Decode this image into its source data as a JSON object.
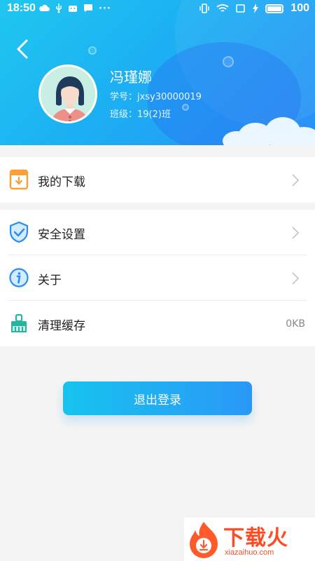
{
  "status_bar": {
    "time": "18:50",
    "battery": "100"
  },
  "profile": {
    "name": "冯瑾娜",
    "student_id": "学号：jxsy30000019",
    "class": "班级：19(2)班"
  },
  "menu_group_1": [
    {
      "label": "我的下载",
      "icon": "download-book-icon"
    }
  ],
  "menu_group_2": [
    {
      "label": "安全设置",
      "icon": "shield-check-icon"
    },
    {
      "label": "关于",
      "icon": "info-icon"
    },
    {
      "label": "清理缓存",
      "icon": "broom-icon",
      "value": "0KB"
    }
  ],
  "logout_label": "退出登录",
  "watermark": {
    "title": "下载火",
    "site": "xiazaihuo.com"
  },
  "colors": {
    "header_gradient_start": "#1fc7ef",
    "header_gradient_end": "#2a8ff5",
    "icon_orange": "#f6a13a",
    "icon_blue": "#2c8cf0",
    "icon_green": "#23b5a0",
    "watermark_red": "#ff4a22"
  }
}
